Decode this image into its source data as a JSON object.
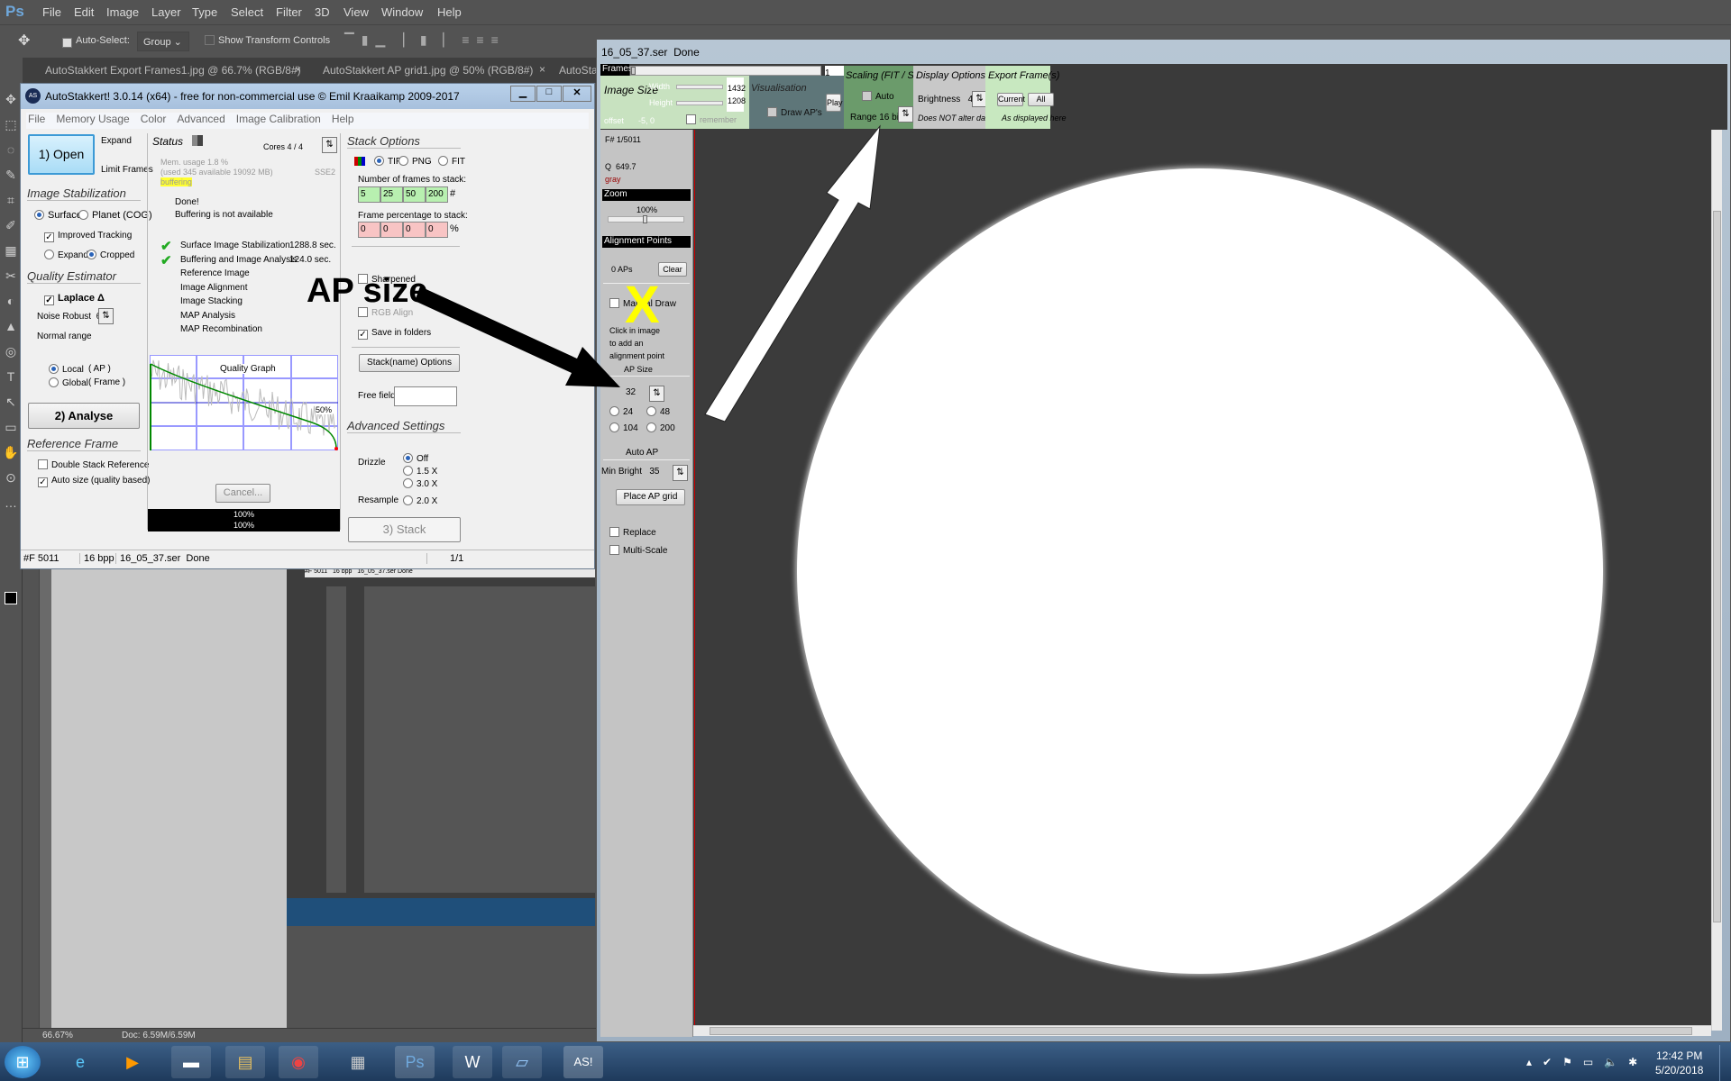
{
  "photoshop": {
    "logo": "Ps",
    "menu": [
      "File",
      "Edit",
      "Image",
      "Layer",
      "Type",
      "Select",
      "Filter",
      "3D",
      "View",
      "Window",
      "Help"
    ],
    "options": {
      "auto_select_label": "Auto-Select:",
      "auto_select_checked": true,
      "group_value": "Group",
      "show_transform_label": "Show Transform Controls",
      "show_transform_checked": false
    },
    "tabs": [
      "AutoStakkert Export Frames1.jpg @ 66.7% (RGB/8#)",
      "AutoStakkert AP grid1.jpg @ 50% (RGB/8#)",
      "AutoSta"
    ],
    "status": {
      "zoom": "66.67%",
      "doc": "Doc: 6.59M/6.59M"
    }
  },
  "as_window": {
    "title": "AutoStakkert! 3.0.14 (x64) - free for non-commercial use © Emil Kraaikamp 2009-2017",
    "menu": [
      "File",
      "Memory Usage",
      "Color",
      "Advanced",
      "Image Calibration",
      "Help"
    ],
    "open_button": "1) Open",
    "expand": "Expand",
    "limit_frames": "Limit Frames",
    "image_stabilization": {
      "title": "Image Stabilization",
      "surface": "Surface",
      "planet": "Planet (COG)",
      "improved_tracking": "Improved Tracking",
      "expand": "Expand",
      "cropped": "Cropped"
    },
    "quality_estimator": {
      "title": "Quality Estimator",
      "laplace": "Laplace Δ",
      "noise_robust": "Noise Robust  6",
      "normal_range": "Normal range",
      "local": "Local",
      "local_ap": "( AP )",
      "global": "Global",
      "global_frame": "( Frame )"
    },
    "analyse_button": "2) Analyse",
    "reference_frame": {
      "title": "Reference Frame",
      "double_stack": "Double Stack Reference",
      "auto_size": "Auto size (quality based)"
    },
    "status": {
      "title": "Status",
      "cores": "Cores 4 / 4",
      "mem_usage": "Mem. usage 1.8 %",
      "mem_detail": "(used 345 available 19092 MB)",
      "buffering": "buffering",
      "sse": "SSE2",
      "done": "Done!",
      "buffer_na": "Buffering is not available",
      "steps": [
        {
          "label": "Surface Image Stabilization",
          "time": "1288.8 sec.",
          "done": true
        },
        {
          "label": "Buffering and Image Analysis",
          "time": "124.0 sec.",
          "done": true
        },
        {
          "label": "Reference Image"
        },
        {
          "label": "Image Alignment"
        },
        {
          "label": "Image Stacking"
        },
        {
          "label": "MAP Analysis"
        },
        {
          "label": "MAP Recombination"
        }
      ],
      "graph_title": "Quality Graph",
      "graph_pct": "50%",
      "cancel": "Cancel...",
      "progress1": "100%",
      "progress2": "100%"
    },
    "stack_options": {
      "title": "Stack Options",
      "tif": "TIF",
      "png": "PNG",
      "fit": "FIT",
      "frames_label": "Number of frames to stack:",
      "frames": [
        "5",
        "25",
        "50",
        "200"
      ],
      "frames_unit": "#",
      "pct_label": "Frame percentage to stack:",
      "pct": [
        "0",
        "0",
        "0",
        "0"
      ],
      "pct_unit": "%",
      "sharpened": "Sharpened",
      "rgb_align": "RGB Align",
      "save_folders": "Save in folders",
      "stack_name": "Stack(name) Options",
      "free_field": "Free field",
      "free_value": ""
    },
    "advanced": {
      "title": "Advanced Settings",
      "drizzle": "Drizzle",
      "off": "Off",
      "x15": "1.5 X",
      "x30": "3.0 X",
      "resample": "Resample",
      "x20": "2.0 X"
    },
    "stack_button": "3) Stack",
    "statusbar": {
      "frame": "#F 5011",
      "bpp": "16 bpp",
      "file": "16_05_37.ser  Done",
      "page": "1/1"
    }
  },
  "img_window": {
    "title": "16_05_37.ser  Done",
    "frames_label": "Frames",
    "frame_value": "1",
    "image_size": {
      "title": "Image Size",
      "width": "Width",
      "height": "Height",
      "width_val": "1432",
      "height_val": "1208",
      "offset": "offset",
      "offset_val": "-5, 0",
      "remember": "remember"
    },
    "visualisation": {
      "title": "Visualisation",
      "draw_aps": "Draw AP's",
      "play": "Play"
    },
    "scaling": {
      "title": "Scaling (FIT / SER)",
      "auto": "Auto",
      "range": "Range 16 bit"
    },
    "display": {
      "title": "Display Options",
      "brightness": "Brightness   4x",
      "note": "Does NOT alter data!"
    },
    "export": {
      "title": "Export Frame(s)",
      "current": "Current",
      "all": "All",
      "note": "As displayed here"
    },
    "side": {
      "frame": "F# 1/5011",
      "q": "Q  649.7",
      "mode": "gray",
      "zoom": "Zoom",
      "zoom_val": "100%",
      "ap_header": "Alignment Points",
      "ap_count": "0 APs",
      "clear": "Clear",
      "manual_draw": "Manual Draw",
      "hint": [
        "Click in image",
        "to add an",
        "alignment point"
      ],
      "ap_size": "AP Size",
      "ap_size_val": "32",
      "sizes": [
        "24",
        "48",
        "104",
        "200"
      ],
      "auto_ap": "Auto AP",
      "min_bright": "Min Bright   35",
      "place_grid": "Place AP grid",
      "replace": "Replace",
      "multi_scale": "Multi-Scale"
    }
  },
  "annotation": {
    "label": "AP size",
    "mark": "X"
  },
  "taskbar": {
    "time": "12:42 PM",
    "date": "5/20/2018",
    "apps": [
      "start",
      "ie",
      "media-player",
      "cmd",
      "explorer",
      "chrome",
      "calculator",
      "photoshop",
      "word",
      "notepad",
      "autostakkert"
    ]
  },
  "colors": {
    "green_field": "#b8f0b0",
    "red_field": "#f8c4c4",
    "open_button": "#bfe6fb",
    "buffering": "#ffff30",
    "annotation_x": "#ffff00"
  }
}
